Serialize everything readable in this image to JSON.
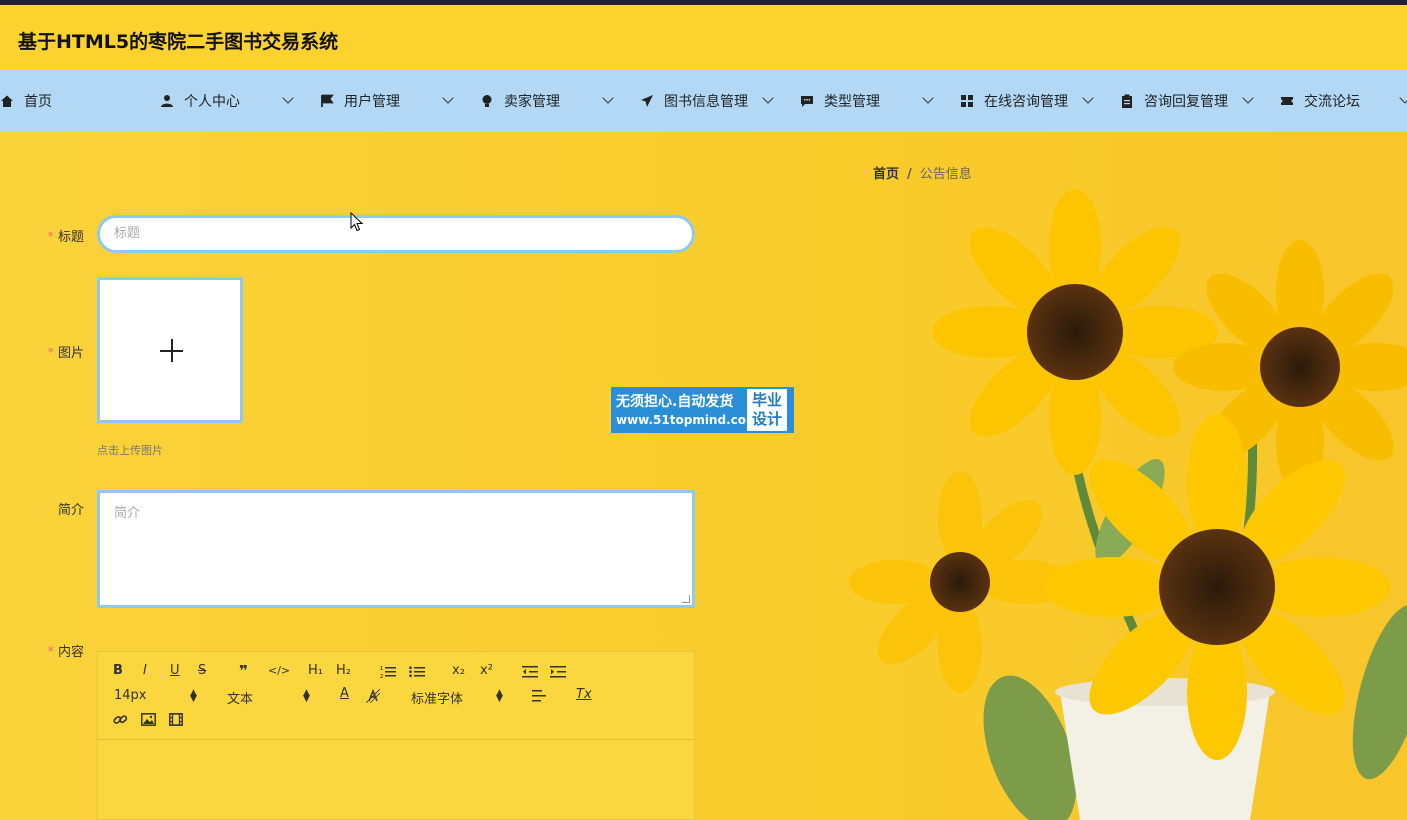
{
  "app": {
    "title": "基于HTML5的枣院二手图书交易系统"
  },
  "nav": {
    "items": [
      {
        "label": "首页",
        "icon": "home-icon"
      },
      {
        "label": "个人中心",
        "icon": "user-icon"
      },
      {
        "label": "用户管理",
        "icon": "flag-icon"
      },
      {
        "label": "卖家管理",
        "icon": "bulb-icon"
      },
      {
        "label": "图书信息管理",
        "icon": "send-icon"
      },
      {
        "label": "类型管理",
        "icon": "chat-icon"
      },
      {
        "label": "在线咨询管理",
        "icon": "grid-icon"
      },
      {
        "label": "咨询回复管理",
        "icon": "clipboard-icon"
      },
      {
        "label": "交流论坛",
        "icon": "ticket-icon"
      }
    ]
  },
  "breadcrumb": {
    "home": "首页",
    "separator": "/",
    "current": "公告信息"
  },
  "form": {
    "title_label": "标题",
    "title_placeholder": "标题",
    "image_label": "图片",
    "image_tip": "点击上传图片",
    "intro_label": "简介",
    "intro_placeholder": "简介",
    "content_label": "内容",
    "required_mark": "*"
  },
  "editor": {
    "bold": "B",
    "italic": "I",
    "underline": "U",
    "strike": "S",
    "quote": "❞",
    "code": "</>",
    "h1": "H₁",
    "h2": "H₂",
    "sub": "x₂",
    "sup": "x²",
    "font_size": "14px",
    "paragraph": "文本",
    "font_family": "标准字体",
    "color": "A",
    "clear": "Tx"
  },
  "watermark": {
    "line1": "无须担心.自动发货",
    "line2": "www.51topmind.com",
    "badge": "毕业设计"
  },
  "colors": {
    "background": "#f8ca2c",
    "nav": "#b3d8f5",
    "input_border": "#8ec9ef",
    "required": "#f56c6c"
  }
}
